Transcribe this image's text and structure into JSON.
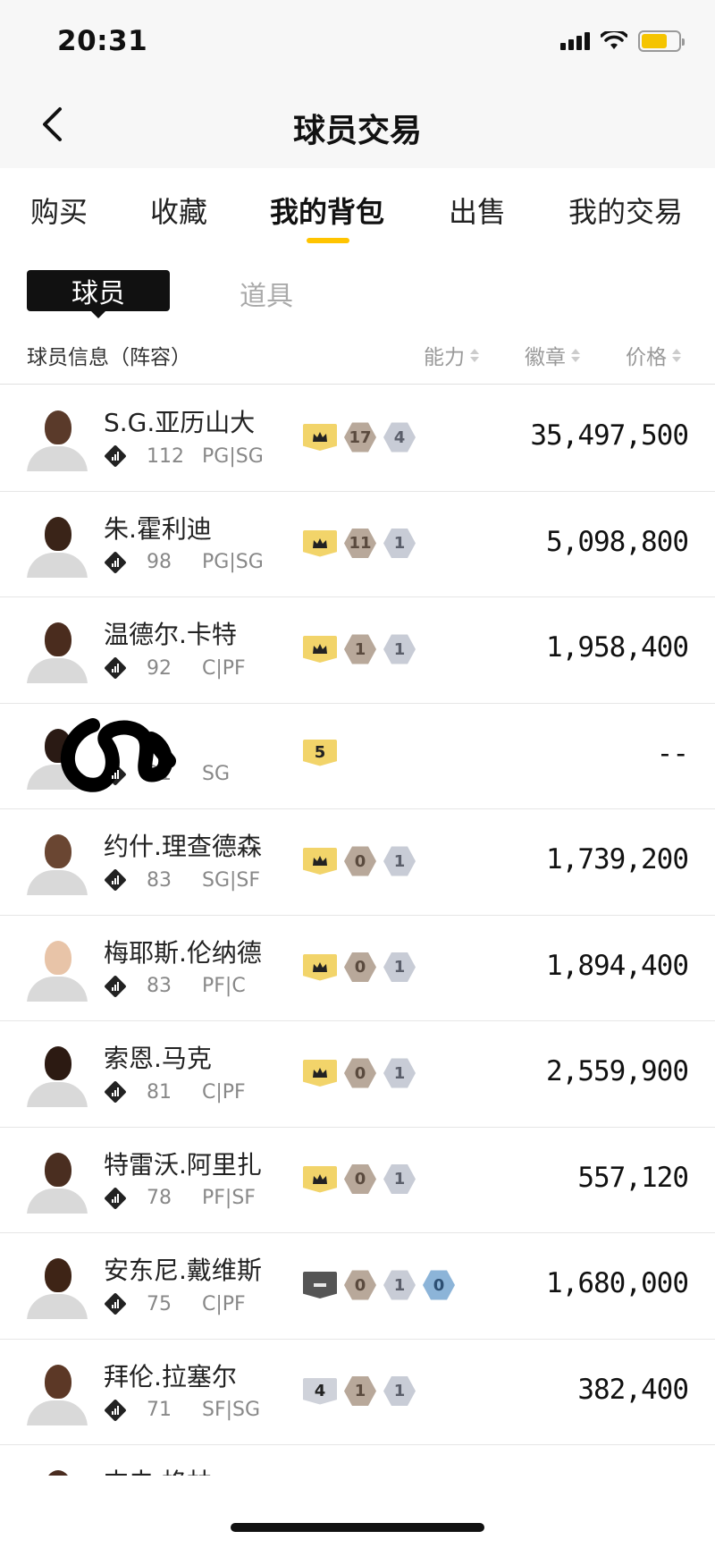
{
  "status_bar": {
    "time": "20:31"
  },
  "nav": {
    "title": "球员交易"
  },
  "tabs": [
    {
      "label": "购买"
    },
    {
      "label": "收藏"
    },
    {
      "label": "我的背包"
    },
    {
      "label": "出售"
    },
    {
      "label": "我的交易"
    }
  ],
  "active_tab": "我的背包",
  "subtabs": [
    {
      "label": "球员"
    },
    {
      "label": "道具"
    }
  ],
  "table_header": {
    "info": "球员信息（阵容）",
    "ability": "能力",
    "badge": "徽章",
    "price": "价格"
  },
  "players": [
    {
      "name": "S.G.亚历山大",
      "ability": "112",
      "position": "PG|SG",
      "tier": "crown",
      "b1": "17",
      "b2": "4",
      "b3": "",
      "price": "35,497,500"
    },
    {
      "name": "朱.霍利迪",
      "ability": "98",
      "position": "PG|SG",
      "tier": "crown",
      "b1": "11",
      "b2": "1",
      "b3": "",
      "price": "5,098,800"
    },
    {
      "name": "温德尔.卡特",
      "ability": "92",
      "position": "C|PF",
      "tier": "crown",
      "b1": "1",
      "b2": "1",
      "b3": "",
      "price": "1,958,400"
    },
    {
      "name": "",
      "ability": "91",
      "position": "SG",
      "tier": "5",
      "b1": "",
      "b2": "",
      "b3": "",
      "price": "--"
    },
    {
      "name": "约什.理查德森",
      "ability": "83",
      "position": "SG|SF",
      "tier": "crown",
      "b1": "0",
      "b2": "1",
      "b3": "",
      "price": "1,739,200"
    },
    {
      "name": "梅耶斯.伦纳德",
      "ability": "83",
      "position": "PF|C",
      "tier": "crown",
      "b1": "0",
      "b2": "1",
      "b3": "",
      "price": "1,894,400"
    },
    {
      "name": "索恩.马克",
      "ability": "81",
      "position": "C|PF",
      "tier": "crown",
      "b1": "0",
      "b2": "1",
      "b3": "",
      "price": "2,559,900"
    },
    {
      "name": "特雷沃.阿里扎",
      "ability": "78",
      "position": "PF|SF",
      "tier": "crown",
      "b1": "0",
      "b2": "1",
      "b3": "",
      "price": "557,120"
    },
    {
      "name": "安东尼.戴维斯",
      "ability": "75",
      "position": "C|PF",
      "tier": "dash",
      "b1": "0",
      "b2": "1",
      "b3": "0",
      "price": "1,680,000"
    },
    {
      "name": "拜伦.拉塞尔",
      "ability": "71",
      "position": "SF|SG",
      "tier": "4",
      "b1": "1",
      "b2": "1",
      "b3": "",
      "price": "382,400"
    },
    {
      "name": "杰夫.格林",
      "ability": "",
      "position": "",
      "tier": "",
      "b1": "",
      "b2": "",
      "b3": "",
      "price": ""
    }
  ],
  "badge_icons": {
    "crown": "crown-icon",
    "diamond": "ability-diamond-icon"
  },
  "colors": {
    "accent": "#ffc400",
    "crown": "#f2d46a",
    "bronze": "#b8a89a",
    "silver": "#c8ccd6",
    "blue": "#8cb4d8"
  }
}
